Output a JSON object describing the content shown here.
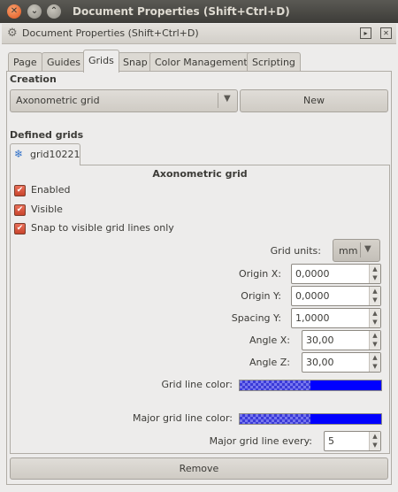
{
  "window": {
    "title": "Document Properties (Shift+Ctrl+D)"
  },
  "dock": {
    "title": "Document Properties (Shift+Ctrl+D)"
  },
  "tabs": [
    "Page",
    "Guides",
    "Grids",
    "Snap",
    "Color Management",
    "Scripting"
  ],
  "active_tab": "Grids",
  "creation": {
    "heading": "Creation",
    "grid_type": "Axonometric grid",
    "new_label": "New"
  },
  "defined": {
    "heading": "Defined grids",
    "grid_tab": "grid10221"
  },
  "grid": {
    "title": "Axonometric grid",
    "enabled_label": "Enabled",
    "visible_label": "Visible",
    "snap_label": "Snap to visible grid lines only",
    "units_label": "Grid units:",
    "units_value": "mm",
    "origin_x_label": "Origin X:",
    "origin_x": "0,0000",
    "origin_y_label": "Origin Y:",
    "origin_y": "0,0000",
    "spacing_y_label": "Spacing Y:",
    "spacing_y": "1,0000",
    "angle_x_label": "Angle X:",
    "angle_x": "30,00",
    "angle_z_label": "Angle Z:",
    "angle_z": "30,00",
    "line_color_label": "Grid line color:",
    "line_color": "#0000ff",
    "major_color_label": "Major grid line color:",
    "major_color": "#0000ff",
    "major_every_label": "Major grid line every:",
    "major_every": "5"
  },
  "remove_label": "Remove",
  "colors": {
    "checkbox": "#d9553b",
    "accent": "#0000ff"
  }
}
